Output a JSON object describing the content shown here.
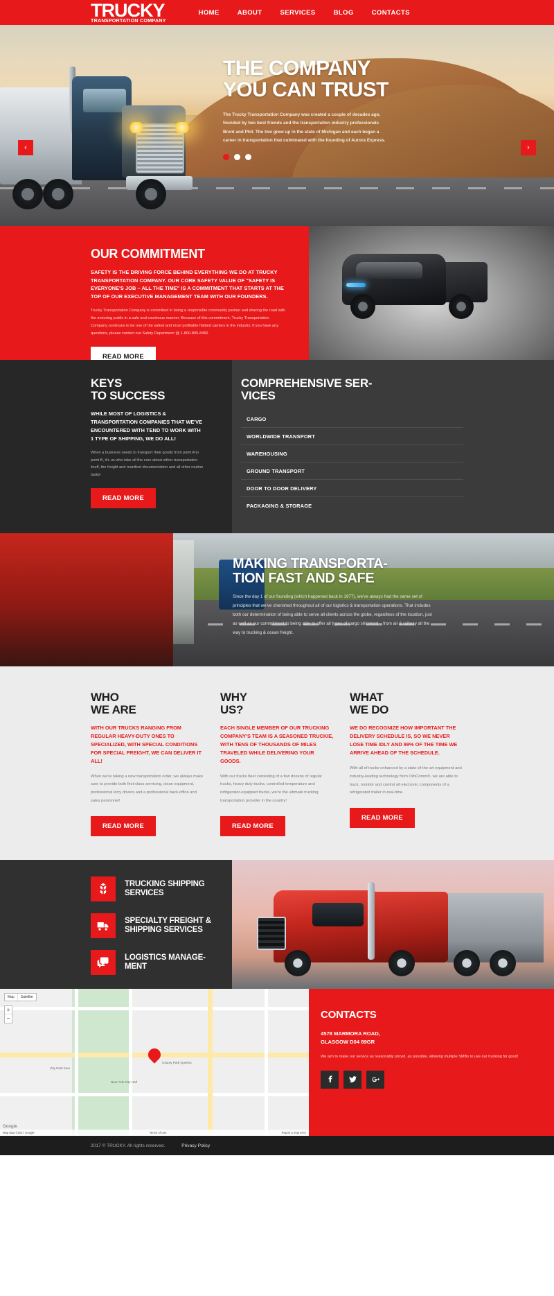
{
  "brand": {
    "name": "TRUCKY",
    "tagline": "TRANSPORTATION COMPANY"
  },
  "nav": {
    "items": [
      "HOME",
      "ABOUT",
      "SERVICES",
      "BLOG",
      "CONTACTS"
    ]
  },
  "hero": {
    "title_line1": "THE COMPANY",
    "title_line2": "YOU CAN TRUST",
    "paragraph": "The Trucky Transportation Company was created a couple of decades ago, founded by two best  friends and the transportation industry professionals Brent and Phil. The two grew up in the state of Michigan and each began a career in transportation that culminated with the founding of Aurora Express.",
    "prev_arrow": "‹",
    "next_arrow": "›",
    "slide_count": 3,
    "active_slide": 1
  },
  "commitment": {
    "title": "OUR COMMITMENT",
    "lead": "SAFETY IS THE DRIVING FORCE BEHIND EVERYTHING WE DO AT TRUCKY TRANSPORTATION COMPANY. OUR CORE SAFETY VALUE OF \"SAFETY IS EVERYONE'S JOB – ALL THE TIME\" IS A COMMITMENT THAT STARTS AT THE TOP OF OUR EXECUTIVE MANAGEMENT TEAM WITH OUR FOUNDERS.",
    "body": "Trucky Transportation Company is committed in being a responsible community partner and sharing the road with the motoring public in a safe and courteous manner. Because of this commitment, Trucky Transportation Company continues to be one of the safest and most profitable flatbed carriers in the industry.  If you have any questions, please contact our Safety Department @ 1-800-895-8456",
    "button": "READ MORE"
  },
  "keys": {
    "title_line1": "KEYS",
    "title_line2": "TO SUCCESS",
    "lead": "WHILE MOST OF LOGISTICS & TRANSPORTATION COMPANIES THAT WE'VE ENCOUNTERED WITH TEND TO WORK WITH 1 TYPE OF SHIPPING, WE DO ALL!",
    "body": "When a business needs to transport their goods from point A to point B, it's us who take all the care about either transportation itself, the freight and manifest documentation and all other routine tasks!",
    "button": "READ MORE"
  },
  "services": {
    "title_line1": "COMPREHENSIVE SER-",
    "title_line2": "VICES",
    "items": [
      "CARGO",
      "WORLDWIDE TRANSPORT",
      "WAREHOUSING",
      "GROUND TRANSPORT",
      "DOOR TO DOOR DELIVERY",
      "PACKAGING & STORAGE"
    ]
  },
  "making": {
    "title_line1": "MAKING TRANSPORTA-",
    "title_line2": "TION FAST AND SAFE",
    "body": "Since the day 1 of our founding (which happened back in 1977), we've always had the same set of principles that we've cherished throughout all of our logistics & transportation operations. That includes both our determination of being able to serve all clients across the globe, regardless of the location, just as well as our commitment to being able to offer all types of cargo shipment – from air & railway all the way to trucking & ocean freight."
  },
  "columns": [
    {
      "title_line1": "WHO",
      "title_line2": "WE ARE",
      "lead": "WITH OUR TRUCKS RANGING FROM REGULAR HEAVY-DUTY ONES TO SPECIALIZED, WITH SPECIAL CONDITIONS FOR SPECIAL FREIGHT, WE CAN DELIVER IT ALL!",
      "body": "When we're taking a new transportation order, we always make sure to provide both first-class servicing, clean equipment, professional lorry drivers and a professional back-office and sales personnel!",
      "button": "READ MORE"
    },
    {
      "title_line1": "WHY",
      "title_line2": "US?",
      "lead": "EACH SINGLE MEMBER OF OUR TRUCKING COMPANY'S TEAM IS A SEASONED TRUCKIE, WITH TENS OF THOUSANDS OF MILES TRAVELED WHILE DELIVERING YOUR GOODS.",
      "body": "With our trucks fleet consisting of a few dozens of regular trucks, heavy duty trucks, controlled-temperature and refrigerator-equipped trucks, we're the ultimate trucking transportation provider in the country!",
      "button": "READ MORE"
    },
    {
      "title_line1": "WHAT",
      "title_line2": "WE DO",
      "lead": "WE DO RECOGNIZE HOW IMPORTANT THE DELIVERY SCHEDULE IS, SO WE NEVER LOSE TIME IDLY AND 99% OF THE TIME WE ARRIVE AHEAD OF THE SCHEDULE.",
      "body": "With all of trucks enhanced by a state-of-the-art equipment and industry-leading technology from OrbComm®, we are able to track, monitor and control all electronic components of a refrigerated trailer in real-time.",
      "button": "READ MORE"
    }
  ],
  "icon_services": [
    {
      "icon": "boxes-icon",
      "label_line1": "TRUCKING SHIPPING",
      "label_line2": "SERVICES"
    },
    {
      "icon": "truck-icon",
      "label_line1": "SPECIALTY FREIGHT &",
      "label_line2": "SHIPPING SERVICES"
    },
    {
      "icon": "chat-icon",
      "label_line1": "LOGISTICS MANAGE-",
      "label_line2": "MENT"
    }
  ],
  "map": {
    "tab_map": "Map",
    "tab_satellite": "Satellite",
    "zoom_in": "+",
    "zoom_out": "−",
    "marker_label": "County Park Queens",
    "labels": [
      "City Park Kew",
      "New York City Hall"
    ],
    "attribution_left": "Map data ©2017 Google",
    "attribution_mid": "Terms of Use",
    "attribution_right": "Report a map error",
    "logo": "Google"
  },
  "contacts": {
    "title": "CONTACTS",
    "address_line1": "4578 MARMORA ROAD,",
    "address_line2": "GLASGOW D04 89GR",
    "body": "We aim to make our service as reasonably priced, as possible, allowing multiple SMBs to use our trucking for good!",
    "socials": [
      "facebook-icon",
      "twitter-icon",
      "google-plus-icon"
    ]
  },
  "footer": {
    "copyright": "2017 © TRUCKY. All rights reserved.",
    "privacy": "Privacy Policy"
  },
  "colors": {
    "accent": "#e8191a",
    "dark": "#272727",
    "darker": "#1d1d1d",
    "light": "#ececec"
  }
}
